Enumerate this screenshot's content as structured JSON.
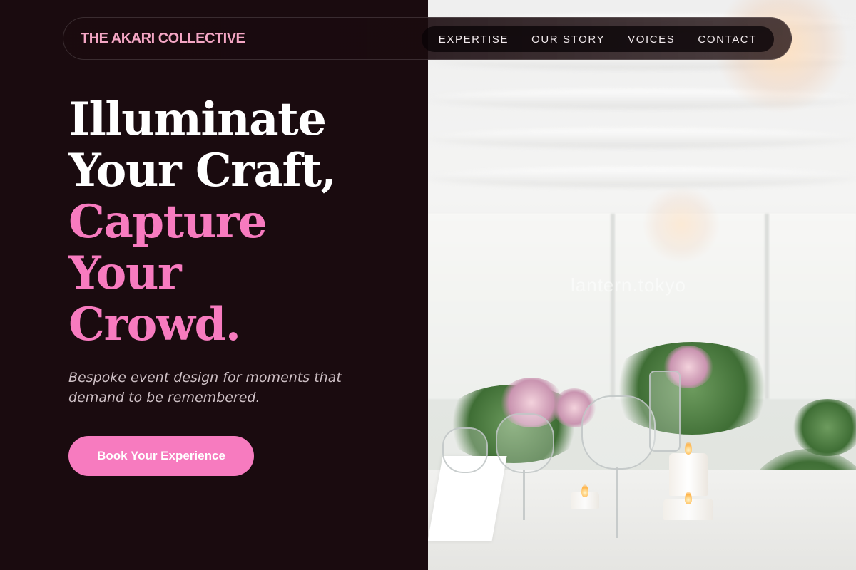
{
  "brand": {
    "name": "THE AKARI COLLECTIVE"
  },
  "nav": {
    "links": [
      {
        "label": "EXPERTISE"
      },
      {
        "label": "OUR STORY"
      },
      {
        "label": "VOICES"
      },
      {
        "label": "CONTACT"
      }
    ]
  },
  "hero": {
    "title_lines": [
      {
        "text": "Illuminate"
      },
      {
        "text": "Your Craft,"
      },
      {
        "text": "Capture"
      },
      {
        "text": "Your"
      },
      {
        "text": "Crowd."
      }
    ],
    "subtitle": "Bespoke event design for moments that demand to be remembered.",
    "cta_label": "Book Your Experience"
  },
  "photo": {
    "watermark": "lantern.tokyo"
  },
  "colors": {
    "background": "#1a0b0f",
    "accent_pink": "#f77bbf",
    "brand_pink": "#f4a6c4",
    "text_white": "#ffffff"
  }
}
